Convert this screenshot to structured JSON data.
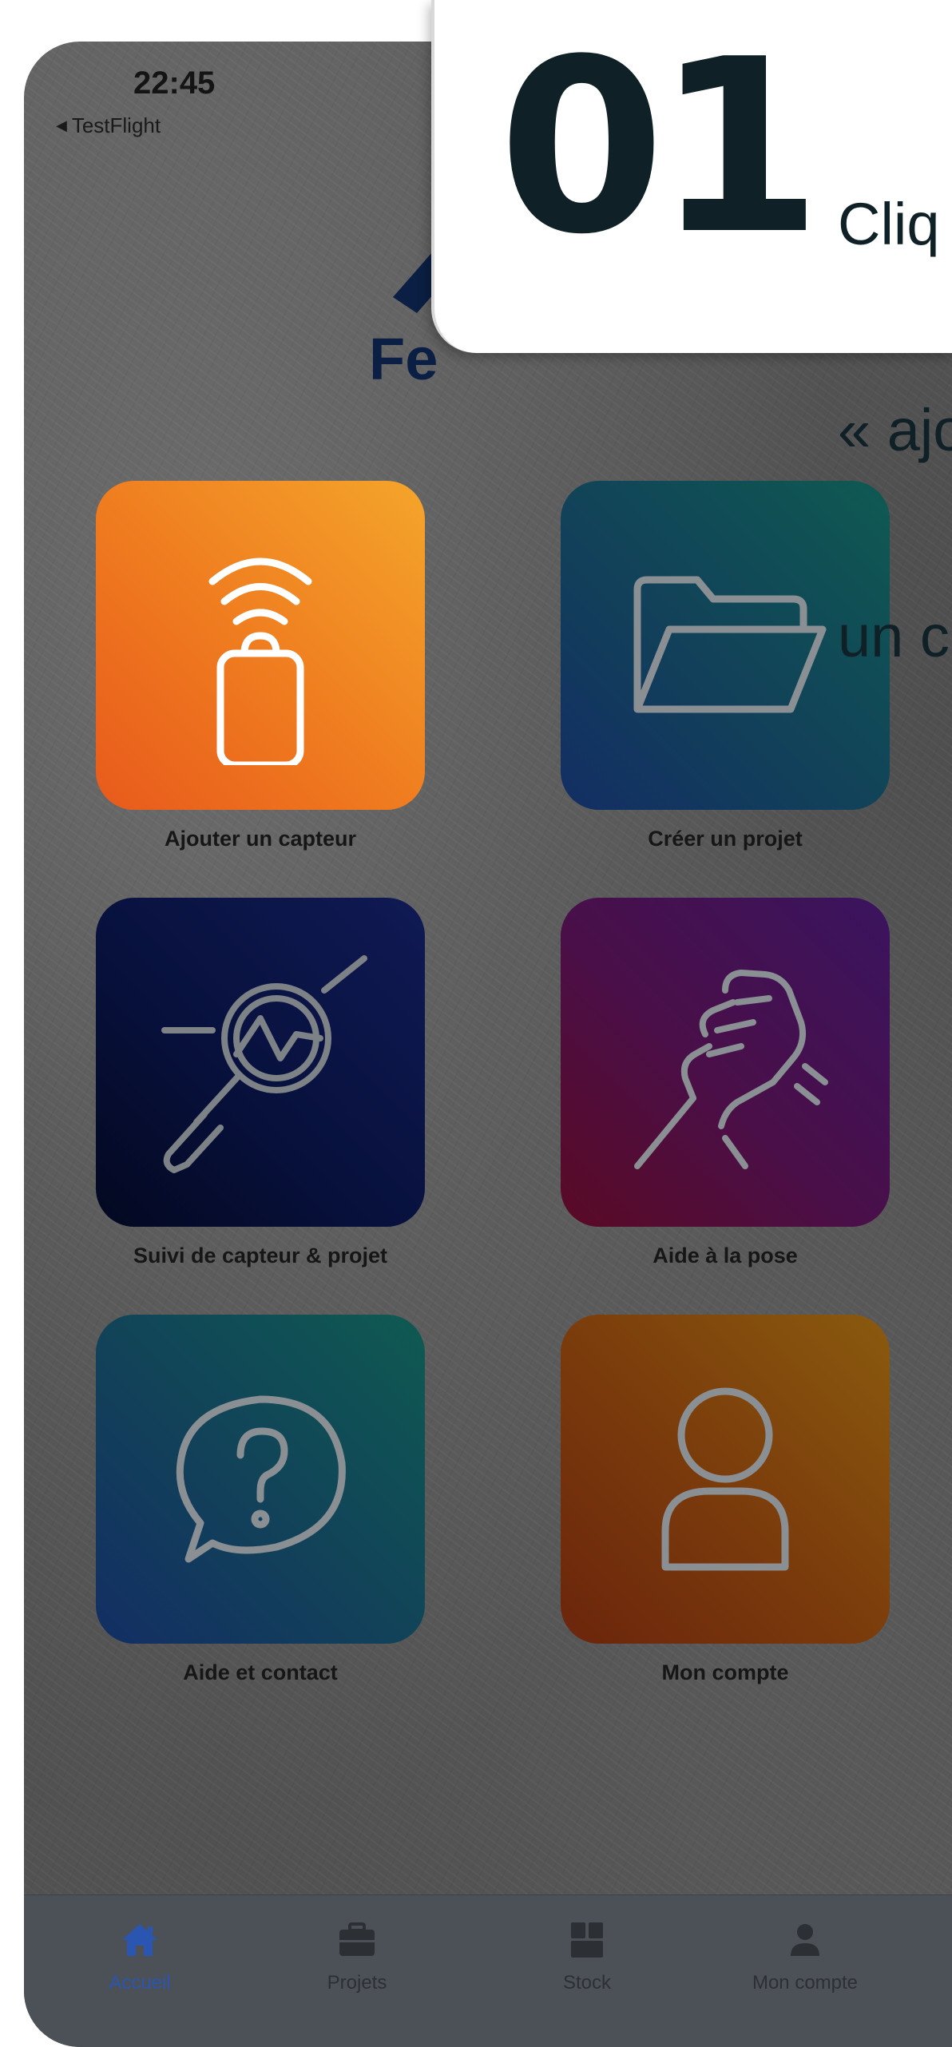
{
  "status_bar": {
    "time": "22:45",
    "back_app": "TestFlight",
    "back_icon": "back-triangle-icon"
  },
  "logo": {
    "visible_text": "Fe",
    "icon": "brand-logo"
  },
  "tiles": [
    {
      "label": "Ajouter un capteur",
      "icon": "nfc-sensor-icon",
      "color": "#ef7a1f"
    },
    {
      "label": "Créer un projet",
      "icon": "folder-icon",
      "color": "#123f5a"
    },
    {
      "label": "Suivi de capteur & projet",
      "icon": "magnifier-graph-icon",
      "color": "#07103a"
    },
    {
      "label": "Aide à la pose",
      "icon": "handshake-icon",
      "color": "#4a0f48"
    },
    {
      "label": "Aide et contact",
      "icon": "question-bubble-icon",
      "color": "#123f5a"
    },
    {
      "label": "Mon compte",
      "icon": "user-icon",
      "color": "#7a3a0c"
    }
  ],
  "tabbar": {
    "items": [
      {
        "label": "Accueil",
        "icon": "home-icon",
        "active": true
      },
      {
        "label": "Projets",
        "icon": "briefcase-icon",
        "active": false
      },
      {
        "label": "Stock",
        "icon": "boxes-icon",
        "active": false
      },
      {
        "label": "Mon compte",
        "icon": "user-icon",
        "active": false
      }
    ],
    "active_color": "#2a55b0"
  },
  "callout": {
    "step_number": "01",
    "text_lines": [
      "Cliq",
      "« ajo",
      "un c"
    ]
  }
}
